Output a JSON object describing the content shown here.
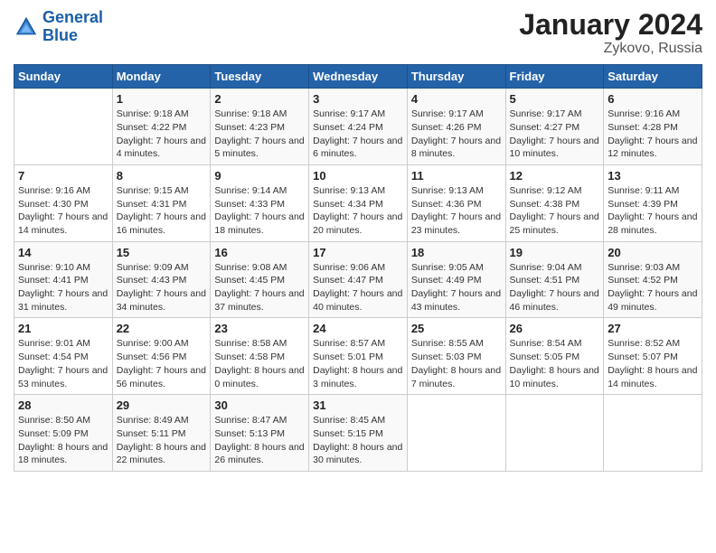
{
  "logo": {
    "line1": "General",
    "line2": "Blue"
  },
  "title": "January 2024",
  "subtitle": "Zykovo, Russia",
  "weekdays": [
    "Sunday",
    "Monday",
    "Tuesday",
    "Wednesday",
    "Thursday",
    "Friday",
    "Saturday"
  ],
  "weeks": [
    [
      {
        "day": "",
        "sunrise": "",
        "sunset": "",
        "daylight": ""
      },
      {
        "day": "1",
        "sunrise": "Sunrise: 9:18 AM",
        "sunset": "Sunset: 4:22 PM",
        "daylight": "Daylight: 7 hours and 4 minutes."
      },
      {
        "day": "2",
        "sunrise": "Sunrise: 9:18 AM",
        "sunset": "Sunset: 4:23 PM",
        "daylight": "Daylight: 7 hours and 5 minutes."
      },
      {
        "day": "3",
        "sunrise": "Sunrise: 9:17 AM",
        "sunset": "Sunset: 4:24 PM",
        "daylight": "Daylight: 7 hours and 6 minutes."
      },
      {
        "day": "4",
        "sunrise": "Sunrise: 9:17 AM",
        "sunset": "Sunset: 4:26 PM",
        "daylight": "Daylight: 7 hours and 8 minutes."
      },
      {
        "day": "5",
        "sunrise": "Sunrise: 9:17 AM",
        "sunset": "Sunset: 4:27 PM",
        "daylight": "Daylight: 7 hours and 10 minutes."
      },
      {
        "day": "6",
        "sunrise": "Sunrise: 9:16 AM",
        "sunset": "Sunset: 4:28 PM",
        "daylight": "Daylight: 7 hours and 12 minutes."
      }
    ],
    [
      {
        "day": "7",
        "sunrise": "Sunrise: 9:16 AM",
        "sunset": "Sunset: 4:30 PM",
        "daylight": "Daylight: 7 hours and 14 minutes."
      },
      {
        "day": "8",
        "sunrise": "Sunrise: 9:15 AM",
        "sunset": "Sunset: 4:31 PM",
        "daylight": "Daylight: 7 hours and 16 minutes."
      },
      {
        "day": "9",
        "sunrise": "Sunrise: 9:14 AM",
        "sunset": "Sunset: 4:33 PM",
        "daylight": "Daylight: 7 hours and 18 minutes."
      },
      {
        "day": "10",
        "sunrise": "Sunrise: 9:13 AM",
        "sunset": "Sunset: 4:34 PM",
        "daylight": "Daylight: 7 hours and 20 minutes."
      },
      {
        "day": "11",
        "sunrise": "Sunrise: 9:13 AM",
        "sunset": "Sunset: 4:36 PM",
        "daylight": "Daylight: 7 hours and 23 minutes."
      },
      {
        "day": "12",
        "sunrise": "Sunrise: 9:12 AM",
        "sunset": "Sunset: 4:38 PM",
        "daylight": "Daylight: 7 hours and 25 minutes."
      },
      {
        "day": "13",
        "sunrise": "Sunrise: 9:11 AM",
        "sunset": "Sunset: 4:39 PM",
        "daylight": "Daylight: 7 hours and 28 minutes."
      }
    ],
    [
      {
        "day": "14",
        "sunrise": "Sunrise: 9:10 AM",
        "sunset": "Sunset: 4:41 PM",
        "daylight": "Daylight: 7 hours and 31 minutes."
      },
      {
        "day": "15",
        "sunrise": "Sunrise: 9:09 AM",
        "sunset": "Sunset: 4:43 PM",
        "daylight": "Daylight: 7 hours and 34 minutes."
      },
      {
        "day": "16",
        "sunrise": "Sunrise: 9:08 AM",
        "sunset": "Sunset: 4:45 PM",
        "daylight": "Daylight: 7 hours and 37 minutes."
      },
      {
        "day": "17",
        "sunrise": "Sunrise: 9:06 AM",
        "sunset": "Sunset: 4:47 PM",
        "daylight": "Daylight: 7 hours and 40 minutes."
      },
      {
        "day": "18",
        "sunrise": "Sunrise: 9:05 AM",
        "sunset": "Sunset: 4:49 PM",
        "daylight": "Daylight: 7 hours and 43 minutes."
      },
      {
        "day": "19",
        "sunrise": "Sunrise: 9:04 AM",
        "sunset": "Sunset: 4:51 PM",
        "daylight": "Daylight: 7 hours and 46 minutes."
      },
      {
        "day": "20",
        "sunrise": "Sunrise: 9:03 AM",
        "sunset": "Sunset: 4:52 PM",
        "daylight": "Daylight: 7 hours and 49 minutes."
      }
    ],
    [
      {
        "day": "21",
        "sunrise": "Sunrise: 9:01 AM",
        "sunset": "Sunset: 4:54 PM",
        "daylight": "Daylight: 7 hours and 53 minutes."
      },
      {
        "day": "22",
        "sunrise": "Sunrise: 9:00 AM",
        "sunset": "Sunset: 4:56 PM",
        "daylight": "Daylight: 7 hours and 56 minutes."
      },
      {
        "day": "23",
        "sunrise": "Sunrise: 8:58 AM",
        "sunset": "Sunset: 4:58 PM",
        "daylight": "Daylight: 8 hours and 0 minutes."
      },
      {
        "day": "24",
        "sunrise": "Sunrise: 8:57 AM",
        "sunset": "Sunset: 5:01 PM",
        "daylight": "Daylight: 8 hours and 3 minutes."
      },
      {
        "day": "25",
        "sunrise": "Sunrise: 8:55 AM",
        "sunset": "Sunset: 5:03 PM",
        "daylight": "Daylight: 8 hours and 7 minutes."
      },
      {
        "day": "26",
        "sunrise": "Sunrise: 8:54 AM",
        "sunset": "Sunset: 5:05 PM",
        "daylight": "Daylight: 8 hours and 10 minutes."
      },
      {
        "day": "27",
        "sunrise": "Sunrise: 8:52 AM",
        "sunset": "Sunset: 5:07 PM",
        "daylight": "Daylight: 8 hours and 14 minutes."
      }
    ],
    [
      {
        "day": "28",
        "sunrise": "Sunrise: 8:50 AM",
        "sunset": "Sunset: 5:09 PM",
        "daylight": "Daylight: 8 hours and 18 minutes."
      },
      {
        "day": "29",
        "sunrise": "Sunrise: 8:49 AM",
        "sunset": "Sunset: 5:11 PM",
        "daylight": "Daylight: 8 hours and 22 minutes."
      },
      {
        "day": "30",
        "sunrise": "Sunrise: 8:47 AM",
        "sunset": "Sunset: 5:13 PM",
        "daylight": "Daylight: 8 hours and 26 minutes."
      },
      {
        "day": "31",
        "sunrise": "Sunrise: 8:45 AM",
        "sunset": "Sunset: 5:15 PM",
        "daylight": "Daylight: 8 hours and 30 minutes."
      },
      {
        "day": "",
        "sunrise": "",
        "sunset": "",
        "daylight": ""
      },
      {
        "day": "",
        "sunrise": "",
        "sunset": "",
        "daylight": ""
      },
      {
        "day": "",
        "sunrise": "",
        "sunset": "",
        "daylight": ""
      }
    ]
  ]
}
